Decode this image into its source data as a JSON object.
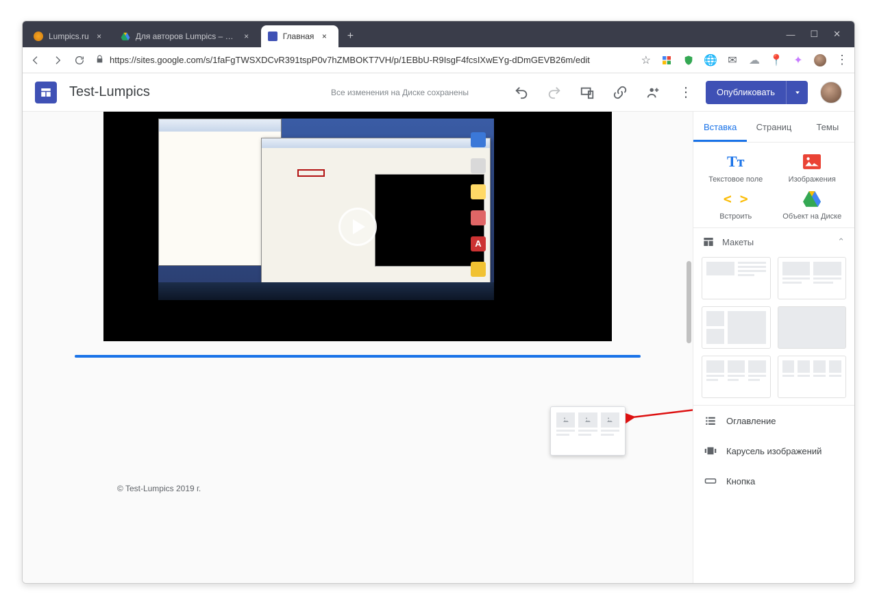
{
  "browser": {
    "tabs": [
      {
        "title": "Lumpics.ru",
        "favicon": "orange"
      },
      {
        "title": "Для авторов Lumpics – Google Д",
        "favicon": "drive"
      },
      {
        "title": "Главная",
        "favicon": "sites",
        "active": true
      }
    ],
    "newtab": "+",
    "win": {
      "min": "—",
      "max": "☐",
      "close": "✕"
    },
    "url": "https://sites.google.com/s/1faFgTWSXDCvR391tspP0v7hZMBOKT7VH/p/1EBbU-R9IsgF4fcsIXwEYg-dDmGEVB26m/edit",
    "star": "☆"
  },
  "sites": {
    "title": "Test-Lumpics",
    "saved": "Все изменения на Диске сохранены",
    "publish": "Опубликовать"
  },
  "panel": {
    "tabs": {
      "insert": "Вставка",
      "pages": "Страниц",
      "themes": "Темы"
    },
    "tools": {
      "text": "Текстовое поле",
      "image": "Изображения",
      "embed": "Встроить",
      "drive": "Объект на Диске"
    },
    "sect_layouts": "Макеты",
    "list": {
      "toc": "Оглавление",
      "carousel": "Карусель изображений",
      "button": "Кнопка"
    }
  },
  "footer": "© Test-Lumpics 2019 г."
}
